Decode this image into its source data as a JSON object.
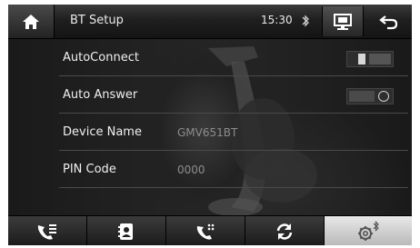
{
  "header": {
    "title": "BT Setup",
    "time": "15:30",
    "home_icon": "home-icon",
    "bluetooth_icon": "bluetooth-icon",
    "screen_icon": "screen-mirror-icon",
    "back_icon": "back-arrow-icon"
  },
  "settings": {
    "autoconnect": {
      "label": "AutoConnect",
      "state": "on"
    },
    "auto_answer": {
      "label": "Auto Answer",
      "state": "off"
    },
    "device_name": {
      "label": "Device Name",
      "value": "GMV651BT"
    },
    "pin_code": {
      "label": "PIN Code",
      "value": "0000"
    }
  },
  "footer": {
    "tabs": [
      {
        "icon": "call-log-icon",
        "active": false
      },
      {
        "icon": "contacts-icon",
        "active": false
      },
      {
        "icon": "dial-pad-icon",
        "active": false
      },
      {
        "icon": "sync-icon",
        "active": false
      },
      {
        "icon": "bt-settings-icon",
        "active": true
      }
    ]
  },
  "colors": {
    "header_bg": "#1f1f1f",
    "text": "#f0f0f0",
    "muted_value": "#8c8c8c",
    "active_tab": "#d0d0d0"
  }
}
